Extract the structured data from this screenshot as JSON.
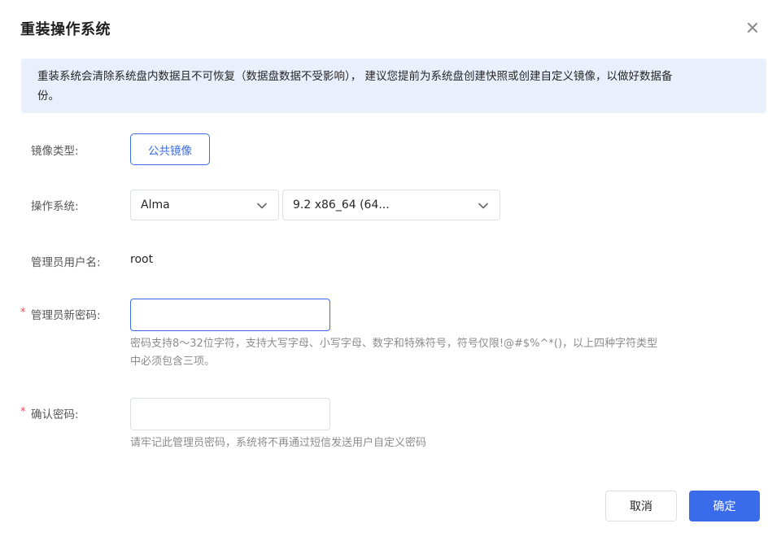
{
  "dialog": {
    "title": "重装操作系统",
    "close_icon": "close-icon",
    "notice": {
      "line1": "重装系统会清除系统盘内数据且不可恢复（数据盘数据不受影响）， 建议您提前为系统盘创建快照或创建自定义镜像，以做好数据备",
      "line2": "份。"
    },
    "image_type": {
      "label": "镜像类型:",
      "button": "公共镜像"
    },
    "os": {
      "label": "操作系统:",
      "distro": "Alma",
      "version": "9.2 x86_64 (64..."
    },
    "admin_user": {
      "label": "管理员用户名:",
      "value": "root"
    },
    "new_password": {
      "required_mark": "*",
      "label": "管理员新密码:",
      "value": "",
      "hint_line1": "密码支持8～32位字符，支持大写字母、小写字母、数字和特殊符号，符号仅限!@#$%^*()，以上四种字符类型",
      "hint_line2": "中必须包含三项。"
    },
    "confirm_password": {
      "required_mark": "*",
      "label": "确认密码:",
      "value": "",
      "hint": "请牢记此管理员密码，系统将不再通过短信发送用户自定义密码"
    },
    "footer": {
      "cancel": "取消",
      "ok": "确定"
    }
  },
  "colors": {
    "accent": "#3a6bea",
    "notice_bg": "#e9f0fc",
    "required": "#e34d59",
    "hint": "#8c8c8c"
  }
}
